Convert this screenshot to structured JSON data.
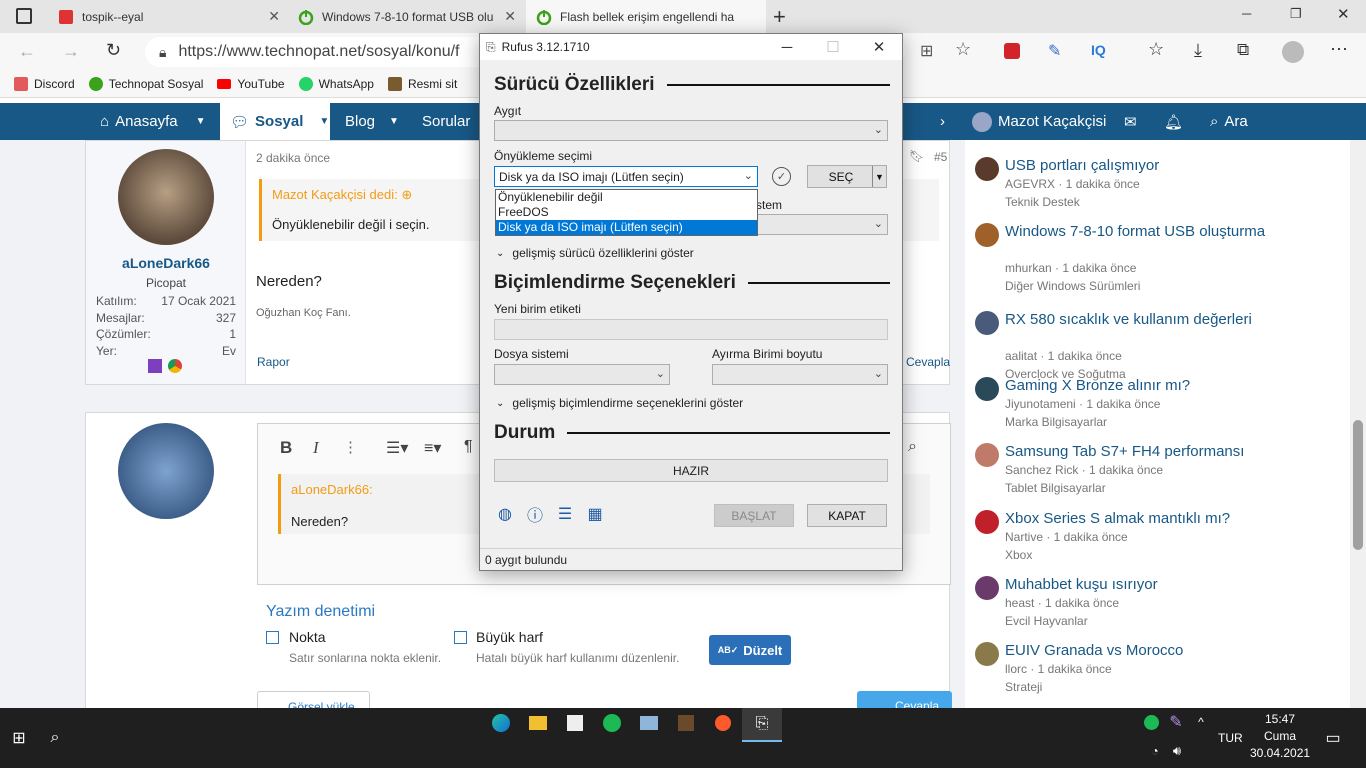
{
  "browser": {
    "tabs": [
      {
        "label": "tospik--eyal"
      },
      {
        "label": "Windows 7-8-10 format USB olu"
      },
      {
        "label": "Flash bellek erişim engellendi ha"
      }
    ],
    "url": "https://www.technopat.net/sosyal/konu/f",
    "bookmarks": [
      "Discord",
      "Technopat Sosyal",
      "YouTube",
      "WhatsApp",
      "Resmi sit"
    ],
    "colors": {
      "tabbar": "#e5e5e5",
      "nav": "#185886"
    }
  },
  "site": {
    "nav": {
      "home": "Anasayfa",
      "social": "Sosyal",
      "blog": "Blog",
      "questions": "Sorular",
      "user": "Mazot Kaçakçisi",
      "search": "Ara"
    },
    "post1": {
      "time": "2 dakika önce",
      "number": "#5",
      "quote_author": "Mazot Kaçakçisi dedi:",
      "quote_text": "Önyüklenebilir değil i seçin.",
      "body": "Nereden?",
      "signature": "Oğuzhan Koç Fanı.",
      "report": "Rapor",
      "reply": "Cevapla",
      "user": {
        "name": "aLoneDark66",
        "title": "Picopat",
        "stats": [
          {
            "label": "Katılım:",
            "value": "17 Ocak 2021"
          },
          {
            "label": "Mesajlar:",
            "value": "327"
          },
          {
            "label": "Çözümler:",
            "value": "1"
          },
          {
            "label": "Yer:",
            "value": "Ev"
          }
        ]
      }
    },
    "editor": {
      "bold": "B",
      "italic": "I",
      "quote_author": "aLoneDark66:",
      "quote_text": "Nereden?"
    },
    "spellcheck": {
      "title": "Yazım denetimi",
      "dot_label": "Nokta",
      "dot_desc": "Satır sonlarına nokta eklenir.",
      "caps_label": "Büyük harf",
      "caps_desc": "Hatalı büyük harf kullanımı düzenlenir.",
      "fix_button": "Düzelt"
    },
    "attach_button": "Görsel yükle",
    "reply_button": "Cevapla",
    "threads": [
      {
        "title": "USB portları çalışmıyor",
        "meta": "AGEVRX · 1 dakika önce",
        "cat": "Teknik Destek"
      },
      {
        "title": "Windows 7-8-10 format USB oluşturma",
        "meta": "mhurkan · 1 dakika önce",
        "cat": "Diğer Windows Sürümleri"
      },
      {
        "title": "RX 580 sıcaklık ve kullanım değerleri",
        "meta": "aalitat · 1 dakika önce",
        "cat": "Overclock ve Soğutma"
      },
      {
        "title": "Gaming X Bronze alınır mı?",
        "meta": "Jiyunotameni · 1 dakika önce",
        "cat": "Marka Bilgisayarlar"
      },
      {
        "title": "Samsung Tab S7+ FH4 performansı",
        "meta": "Sanchez Rick · 1 dakika önce",
        "cat": "Tablet Bilgisayarlar"
      },
      {
        "title": "Xbox Series S almak mantıklı mı?",
        "meta": "Nartive · 1 dakika önce",
        "cat": "Xbox"
      },
      {
        "title": "Muhabbet kuşu ısırıyor",
        "meta": "heast · 1 dakika önce",
        "cat": "Evcil Hayvanlar"
      },
      {
        "title": "EUIV Granada vs Morocco",
        "meta": "llorc · 1 dakika önce",
        "cat": "Strateji"
      }
    ]
  },
  "rufus": {
    "title": "Rufus 3.12.1710",
    "drive_section": "Sürücü Özellikleri",
    "device_label": "Aygıt",
    "boot_label": "Önyükleme seçimi",
    "boot_value": "Disk ya da ISO imajı (Lütfen seçin)",
    "select_button": "SEÇ",
    "boot_options": [
      "Önyüklenebilir değil",
      "FreeDOS",
      "Disk ya da ISO imajı (Lütfen seçin)"
    ],
    "target_label_fragment": "stem",
    "adv_drive": "gelişmiş sürücü özelliklerini göster",
    "format_section": "Biçimlendirme Seçenekleri",
    "volume_label": "Yeni birim etiketi",
    "fs_label": "Dosya sistemi",
    "cluster_label": "Ayırma Birimi boyutu",
    "adv_format": "gelişmiş biçimlendirme seçeneklerini göster",
    "status_section": "Durum",
    "status_text": "HAZIR",
    "start_button": "BAŞLAT",
    "close_button": "KAPAT",
    "statusbar": "0 aygıt bulundu"
  },
  "taskbar": {
    "lang": "TUR",
    "time": "15:47",
    "day": "Cuma",
    "date": "30.04.2021"
  }
}
